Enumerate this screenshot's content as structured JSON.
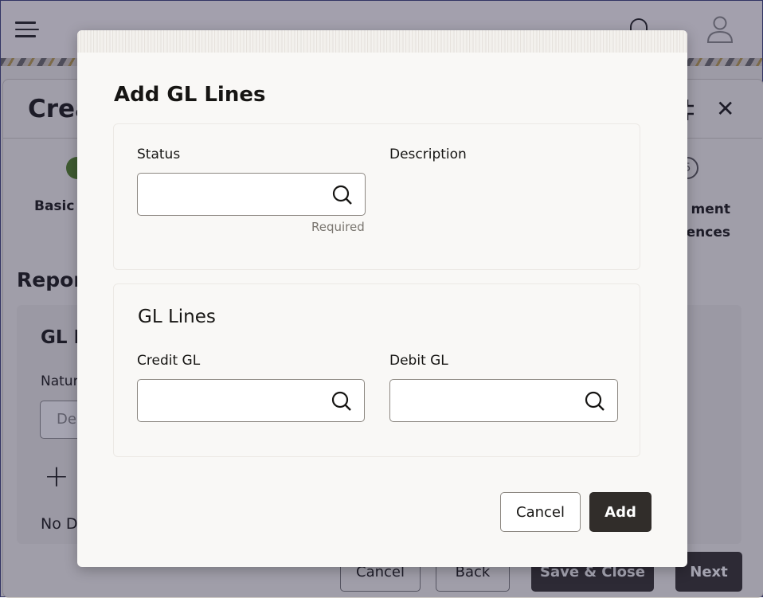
{
  "background": {
    "page_title": "Crea",
    "steps": [
      {
        "label": "Basic I",
        "status": "complete"
      },
      {
        "number": "5",
        "label_lines": [
          "ment",
          "rences"
        ]
      }
    ],
    "section_title": "Repor",
    "panel_title": "GL D",
    "nature_label": "Natur",
    "nature_value": "De",
    "no_data_text": "No D",
    "footer_buttons": {
      "cancel": "Cancel",
      "back": "Back",
      "save_close": "Save & Close",
      "next": "Next"
    }
  },
  "dialog": {
    "title": "Add GL Lines",
    "status": {
      "label": "Status",
      "value": "",
      "hint": "Required"
    },
    "description": {
      "label": "Description"
    },
    "gl_lines": {
      "title": "GL Lines",
      "credit_gl": {
        "label": "Credit GL",
        "value": ""
      },
      "debit_gl": {
        "label": "Debit GL",
        "value": ""
      }
    },
    "buttons": {
      "cancel": "Cancel",
      "add": "Add"
    }
  },
  "icons": {
    "menu": "hamburger-icon",
    "notifications": "bell-icon",
    "user": "user-icon",
    "search": "search-icon",
    "close": "close-icon",
    "minimize": "minimize-icon",
    "add": "plus-icon"
  }
}
